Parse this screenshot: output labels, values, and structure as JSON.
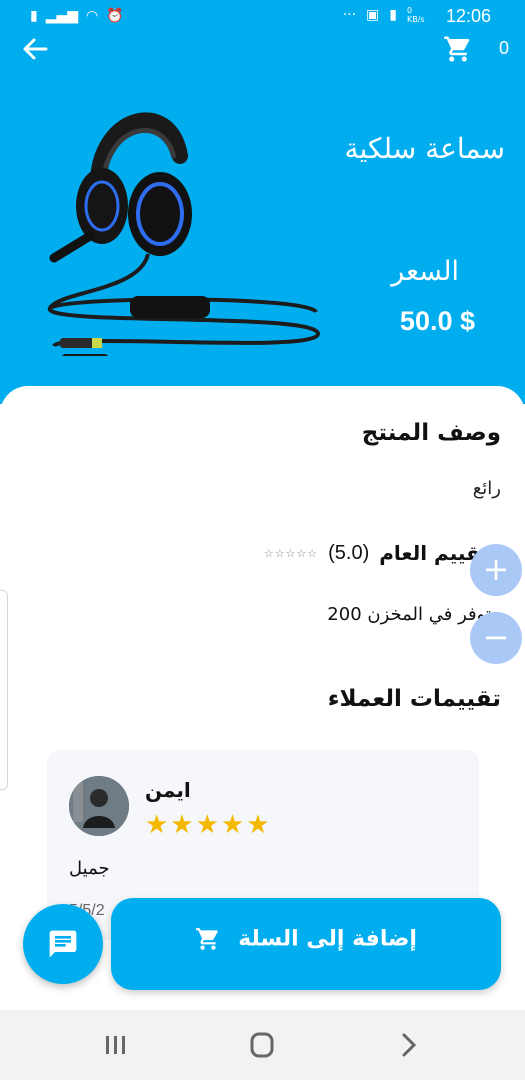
{
  "status_bar": {
    "time": "12:06",
    "data_speed": "0 KB/s"
  },
  "header": {
    "back_icon": "arrow-left-icon",
    "cart_icon": "cart-icon",
    "cart_count": "0"
  },
  "product": {
    "name": "سماعة سلكية",
    "price_label": "السعر",
    "price_value": "50.0 $",
    "image": "wired-gaming-headset"
  },
  "description": {
    "title": "وصف المنتج",
    "text": "رائع"
  },
  "rating": {
    "label": "التقييم العام",
    "value": "(5.0)",
    "stars": 0
  },
  "stock": {
    "text": "متوفر في المخزن 200"
  },
  "quantity": {
    "plus": "+",
    "minus": "−"
  },
  "reviews": {
    "title": "تقييمات العملاء",
    "items": [
      {
        "name": "ايمن",
        "stars": 5,
        "text": "جميل",
        "date": "5/5/2"
      }
    ]
  },
  "actions": {
    "add_to_cart": "إضافة إلى السلة",
    "chat_icon": "chat-icon"
  },
  "colors": {
    "primary": "#00aef0",
    "star": "#f5b800",
    "fab_light": "#a9c8f5"
  }
}
